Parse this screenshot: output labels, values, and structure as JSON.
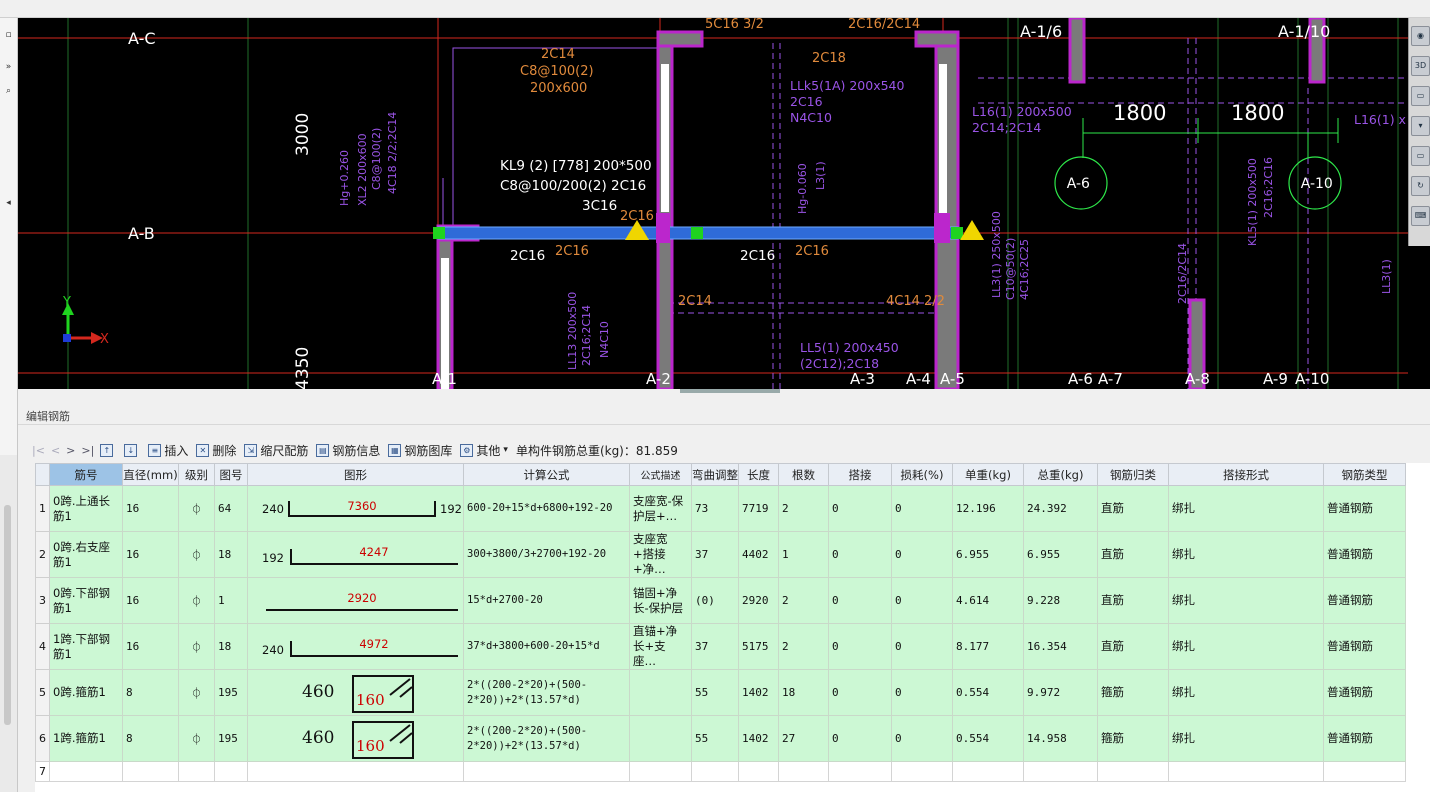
{
  "cad": {
    "axes_h": [
      "A-C",
      "A-B"
    ],
    "axes_v_top": [
      "A-1/6",
      "A-1/10"
    ],
    "axes_v_bottom": [
      "A-1",
      "A-2",
      "A-3",
      "A-4",
      "A-5",
      "A-6",
      "A-7",
      "A-8",
      "A-9",
      "A-10",
      "A-"
    ],
    "circles": [
      "A-6",
      "A-10"
    ],
    "dims": [
      "3000",
      "4350",
      "1800",
      "1800"
    ],
    "white_texts": [
      "KL9 (2) [778] 200*500",
      "C8@100/200(2) 2C16",
      "3C16",
      "2C16",
      "2C16"
    ],
    "orange_texts": [
      "2C14",
      "C8@100(2)",
      "200x600",
      "2C18",
      "2C16",
      "2C14",
      "4C14 2/2",
      "2C16",
      "5C16 3/2",
      "2C16/2C14"
    ],
    "purple_texts": [
      "LLk5(1A) 200x540",
      "2C16",
      "N4C10",
      "L16(1) 200x500",
      "2C14;2C14",
      "L16(1) x",
      "LL5(1) 200x450",
      "(2C12);2C18",
      "Hg-0.060",
      "L3(1)",
      "KL5(1) 200x500",
      "2C16;2C16",
      "LL3(1) 250x500",
      "C10@50(2)",
      "4C16;2C25",
      "LL13 200x500",
      "2C16;2C14",
      "N4C10",
      "Hg+0.260",
      "XL2 200x600",
      "C8@100(2)",
      "4C18 2/2;2C14",
      "2C16/2C14",
      "LL3(1)"
    ],
    "axis_x": "X",
    "axis_y": "Y",
    "colors": {
      "bg": "#000000",
      "axis": "#d4281e",
      "beam_sel": "#2f6bd8",
      "wall": "#7a7a7a",
      "wall_edge": "#bb26cc",
      "text_white": "#ffffff",
      "text_orange": "#e08a3c",
      "text_purple": "#9a54e6",
      "grid_green": "#1f6e2a",
      "circle": "#2ee84a"
    }
  },
  "right_tools": [
    "cube-3d-icon",
    "3d-icon",
    "box-icon",
    "drop-icon",
    "rotate-icon",
    "keyboard-icon"
  ],
  "panel": {
    "title": "编辑钢筋",
    "toolbar": {
      "nav": [
        "|<",
        "<",
        ">",
        ">|"
      ],
      "up_icon": "move-up-icon",
      "down_icon": "move-down-icon",
      "insert": "插入",
      "delete": "删除",
      "scale": "缩尺配筋",
      "info": "钢筋信息",
      "library": "钢筋图库",
      "other": "其他",
      "other_arrow": "▾",
      "total": "单构件钢筋总重(kg)：81.859"
    }
  },
  "grid": {
    "headers": [
      "筋号",
      "直径(mm)",
      "级别",
      "图号",
      "图形",
      "计算公式",
      "公式描述",
      "弯曲调整",
      "长度",
      "根数",
      "搭接",
      "损耗(%)",
      "单重(kg)",
      "总重(kg)",
      "钢筋归类",
      "搭接形式",
      "钢筋类型"
    ],
    "grade_symbol": "⏀",
    "rows": [
      {
        "n": "1",
        "name": "0跨.上通长筋1",
        "d": "16",
        "g": "⏀",
        "fig": "64",
        "shape": {
          "type": "u",
          "left": "240",
          "mid": "7360",
          "right": "192"
        },
        "formula": "600-20+15*d+6800+192-20",
        "desc": "支座宽-保护层+…",
        "bend": "73",
        "len": "7719",
        "cnt": "2",
        "lap": "0",
        "loss": "0",
        "unit": "12.196",
        "total": "24.392",
        "cat": "直筋",
        "lapform": "绑扎",
        "type": "普通钢筋"
      },
      {
        "n": "2",
        "name": "0跨.右支座筋1",
        "d": "16",
        "g": "⏀",
        "fig": "18",
        "shape": {
          "type": "l",
          "left": "192",
          "mid": "4247",
          "right": ""
        },
        "formula": "300+3800/3+2700+192-20",
        "desc": "支座宽+搭接+净…",
        "bend": "37",
        "len": "4402",
        "cnt": "1",
        "lap": "0",
        "loss": "0",
        "unit": "6.955",
        "total": "6.955",
        "cat": "直筋",
        "lapform": "绑扎",
        "type": "普通钢筋"
      },
      {
        "n": "3",
        "name": "0跨.下部钢筋1",
        "d": "16",
        "g": "⏀",
        "fig": "1",
        "shape": {
          "type": "line",
          "left": "",
          "mid": "2920",
          "right": ""
        },
        "formula": "15*d+2700-20",
        "desc": "锚固+净长-保护层",
        "bend": "(0)",
        "len": "2920",
        "cnt": "2",
        "lap": "0",
        "loss": "0",
        "unit": "4.614",
        "total": "9.228",
        "cat": "直筋",
        "lapform": "绑扎",
        "type": "普通钢筋"
      },
      {
        "n": "4",
        "name": "1跨.下部钢筋1",
        "d": "16",
        "g": "⏀",
        "fig": "18",
        "shape": {
          "type": "l",
          "left": "240",
          "mid": "4972",
          "right": ""
        },
        "formula": "37*d+3800+600-20+15*d",
        "desc": "直锚+净长+支座…",
        "bend": "37",
        "len": "5175",
        "cnt": "2",
        "lap": "0",
        "loss": "0",
        "unit": "8.177",
        "total": "16.354",
        "cat": "直筋",
        "lapform": "绑扎",
        "type": "普通钢筋"
      },
      {
        "n": "5",
        "name": "0跨.箍筋1",
        "d": "8",
        "g": "⏀",
        "fig": "195",
        "shape": {
          "type": "box",
          "left": "460",
          "mid": "160",
          "right": ""
        },
        "formula": "2*((200-2*20)+(500-2*20))+2*(13.57*d)",
        "desc": "",
        "bend": "55",
        "len": "1402",
        "cnt": "18",
        "lap": "0",
        "loss": "0",
        "unit": "0.554",
        "total": "9.972",
        "cat": "箍筋",
        "lapform": "绑扎",
        "type": "普通钢筋"
      },
      {
        "n": "6",
        "name": "1跨.箍筋1",
        "d": "8",
        "g": "⏀",
        "fig": "195",
        "shape": {
          "type": "box",
          "left": "460",
          "mid": "160",
          "right": ""
        },
        "formula": "2*((200-2*20)+(500-2*20))+2*(13.57*d)",
        "desc": "",
        "bend": "55",
        "len": "1402",
        "cnt": "27",
        "lap": "0",
        "loss": "0",
        "unit": "0.554",
        "total": "14.958",
        "cat": "箍筋",
        "lapform": "绑扎",
        "type": "普通钢筋"
      }
    ],
    "empty_row": "7"
  }
}
